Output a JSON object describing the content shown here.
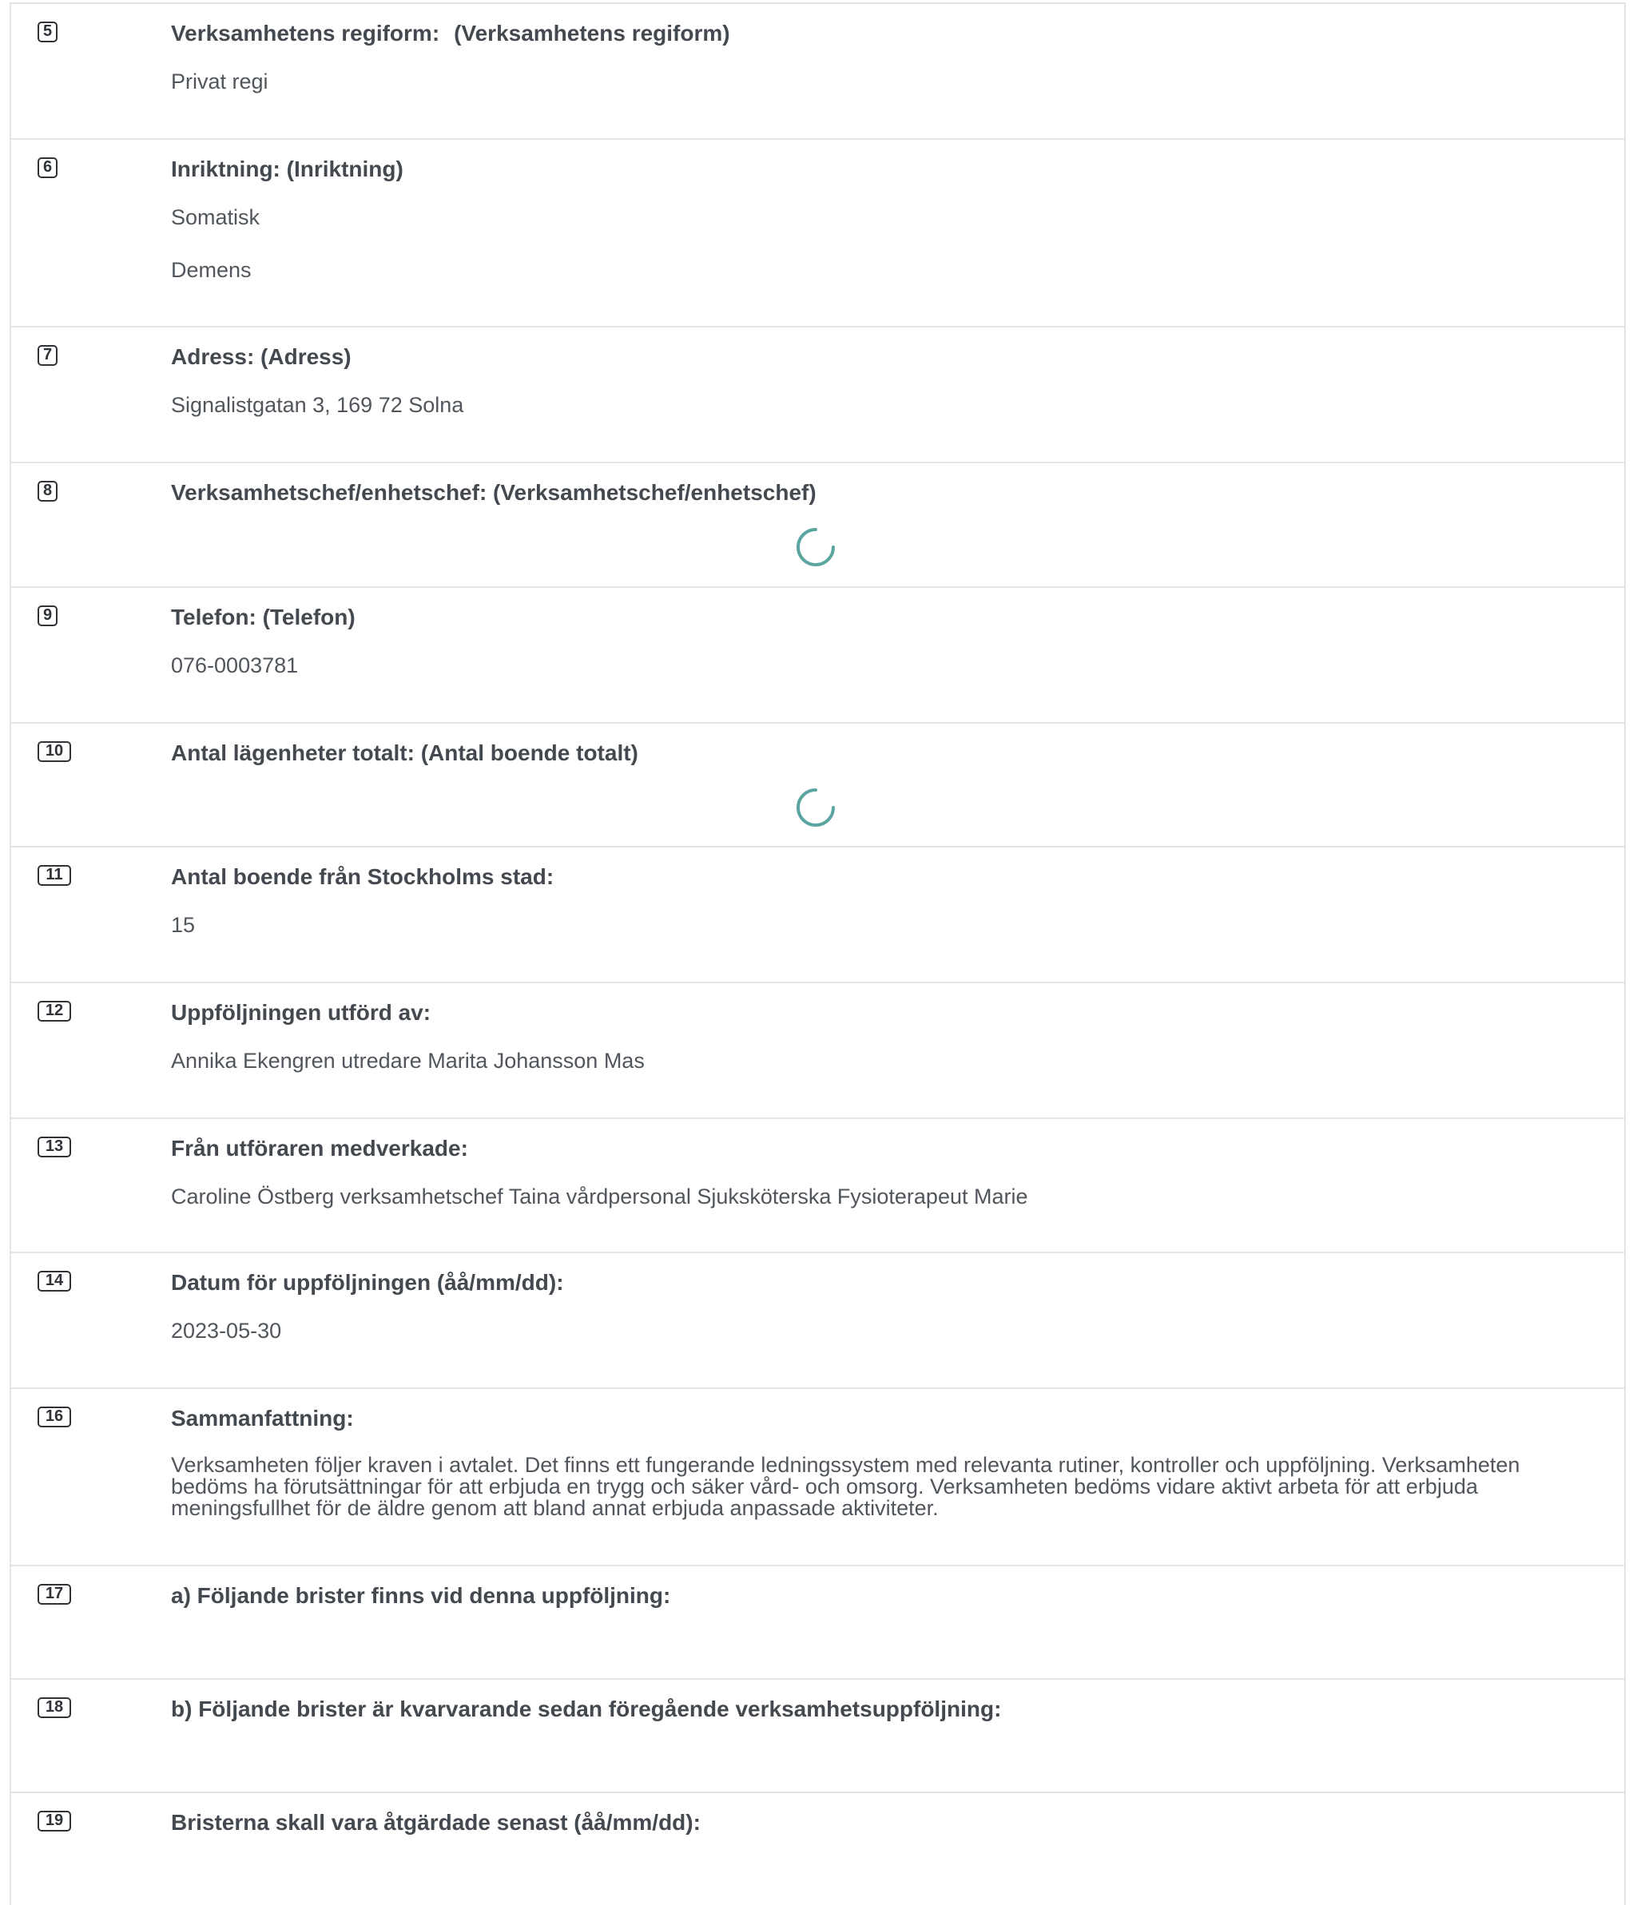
{
  "rows": [
    {
      "num": "5",
      "label": "Verksamhetens regiform:",
      "label2": "(Verksamhetens regiform)",
      "values": [
        "Privat regi"
      ]
    },
    {
      "num": "6",
      "label": "Inriktning: (Inriktning)",
      "values": [
        "Somatisk",
        "Demens"
      ]
    },
    {
      "num": "7",
      "label": "Adress: (Adress)",
      "values": [
        "Signalistgatan 3, 169 72 Solna"
      ]
    },
    {
      "num": "8",
      "label": "Verksamhetschef/enhetschef: (Verksamhetschef/enhetschef)",
      "loading": true
    },
    {
      "num": "9",
      "label": "Telefon: (Telefon)",
      "values": [
        "076-0003781"
      ]
    },
    {
      "num": "10",
      "label": "Antal lägenheter totalt: (Antal boende totalt)",
      "loading": true
    },
    {
      "num": "11",
      "label": "Antal boende från Stockholms stad:",
      "values": [
        "15"
      ]
    },
    {
      "num": "12",
      "label": "Uppföljningen utförd av:",
      "values": [
        "Annika Ekengren utredare Marita Johansson Mas"
      ]
    },
    {
      "num": "13",
      "label": "Från utföraren medverkade:",
      "values": [
        "Caroline Östberg verksamhetschef Taina vårdpersonal Sjuksköterska Fysioterapeut Marie"
      ]
    },
    {
      "num": "14",
      "label": "Datum för uppföljningen (åå/mm/dd):",
      "values": [
        "2023-05-30"
      ]
    },
    {
      "num": "16",
      "label": "Sammanfattning:",
      "values": [
        "Verksamheten följer kraven i avtalet. Det finns ett fungerande ledningssystem med relevanta rutiner, kontroller och uppföljning. Verksamheten bedöms ha förutsättningar för att erbjuda en trygg och säker vård- och omsorg. Verksamheten bedöms vidare aktivt arbeta för att erbjuda meningsfullhet för de äldre genom att bland annat erbjuda anpassade aktiviteter."
      ]
    },
    {
      "num": "17",
      "label": "a) Följande brister finns vid denna uppföljning:"
    },
    {
      "num": "18",
      "label": "b) Följande brister är kvarvarande sedan föregående verksamhetsuppföljning:"
    },
    {
      "num": "19",
      "label": "Bristerna skall vara åtgärdade senast (åå/mm/dd):"
    }
  ],
  "colors": {
    "spinner": "#5aa5a0",
    "border": "#e2e4e6",
    "label": "#44494f",
    "value": "#50565c"
  },
  "icons": {
    "loading": "loading-spinner-icon"
  }
}
